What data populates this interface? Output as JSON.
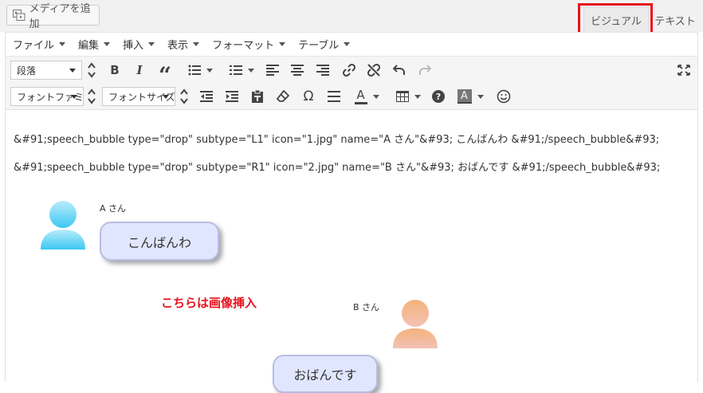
{
  "header": {
    "add_media_label": "メディアを追加",
    "tabs": {
      "visual": "ビジュアル",
      "text": "テキスト"
    },
    "highlight_color": "#e8121b"
  },
  "menubar": [
    "ファイル",
    "編集",
    "挿入",
    "表示",
    "フォーマット",
    "テーブル"
  ],
  "toolbar": {
    "format_select": "段落",
    "font_family_select": "フォントファミリー",
    "font_size_select": "フォントサイズ",
    "row1_icons": [
      "bold-icon",
      "italic-icon",
      "blockquote-icon",
      "bullet-list-icon",
      "numbered-list-icon",
      "align-left-icon",
      "align-center-icon",
      "align-right-icon",
      "link-icon",
      "unlink-icon",
      "undo-icon",
      "redo-icon",
      "fullscreen-icon"
    ],
    "row2_icons": [
      "outdent-icon",
      "indent-icon",
      "paste-text-icon",
      "clear-format-icon",
      "special-char-icon",
      "horizontal-rule-icon",
      "text-color-icon",
      "table-icon",
      "help-icon",
      "background-color-icon",
      "emoticon-icon"
    ],
    "bold_glyph": "B",
    "italic_glyph": "I",
    "quote_glyph": "“",
    "omega_glyph": "Ω",
    "help_glyph": "?",
    "text_color_glyph": "A",
    "bg_color_glyph": "A"
  },
  "content": {
    "shortcode_lines": [
      "&#91;speech_bubble type=\"drop\" subtype=\"L1\" icon=\"1.jpg\" name=\"A さん\"&#93; こんばんわ &#91;/speech_bubble&#93;",
      "&#91;speech_bubble type=\"drop\" subtype=\"R1\" icon=\"2.jpg\" name=\"B さん\"&#93; おばんです &#91;/speech_bubble&#93;"
    ],
    "bubbles": [
      {
        "speaker": "A さん",
        "text": "こんばんわ",
        "avatar_color": "#5fd3f5"
      },
      {
        "speaker": "B さん",
        "text": "おばんです",
        "avatar_color": "#f4b07e"
      }
    ],
    "annotation": "こちらは画像挿入",
    "bubble_fill": "#e1e6ff"
  }
}
